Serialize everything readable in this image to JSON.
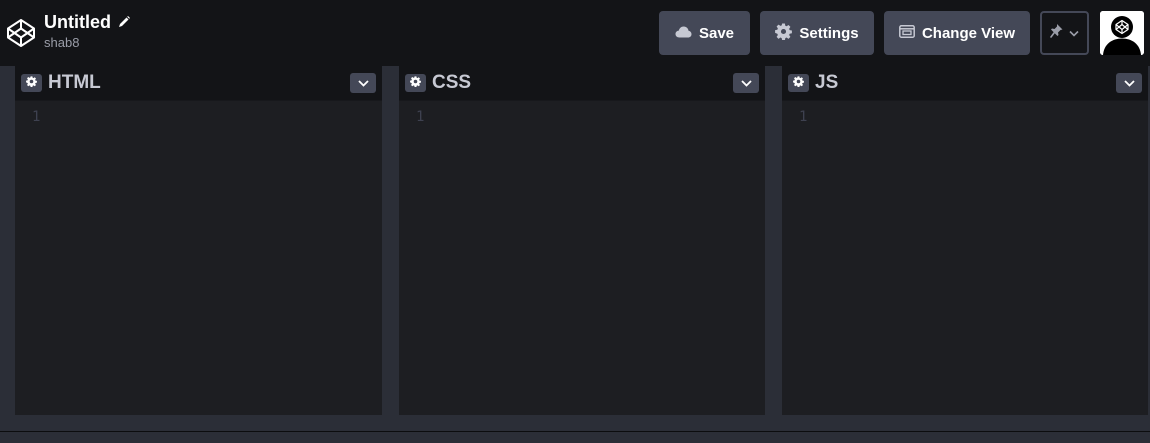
{
  "pen": {
    "title": "Untitled",
    "author": "shab8"
  },
  "toolbar": {
    "save_label": "Save",
    "settings_label": "Settings",
    "change_view_label": "Change View"
  },
  "editors": [
    {
      "label": "HTML",
      "line_number": "1"
    },
    {
      "label": "CSS",
      "line_number": "1"
    },
    {
      "label": "JS",
      "line_number": "1"
    }
  ],
  "icons": {
    "logo": "codepen-logo-icon",
    "edit_title": "pencil-icon",
    "save": "cloud-icon",
    "settings": "gear-icon",
    "change_view": "layout-icon",
    "pin": "pin-icon",
    "dropdown": "chevron-down-icon"
  },
  "colors": {
    "background": "#131417",
    "button": "#444857",
    "editor": "#1d1e22",
    "label": "#c7c9d3"
  }
}
